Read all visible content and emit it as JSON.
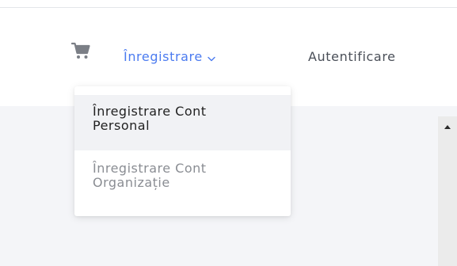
{
  "navbar": {
    "cart_icon": "shopping-cart-icon",
    "register_label": "Înregistrare",
    "register_chevron_icon": "chevron-down-icon",
    "login_label": "Autentificare",
    "accent_color": "#4b7bf0"
  },
  "dropdown": {
    "items": [
      {
        "label_line1": "Înregistrare Cont",
        "label_line2": "Personal",
        "state": "hovered"
      },
      {
        "label_line1": "Înregistrare Cont",
        "label_line2": "Organizație",
        "state": "default"
      }
    ]
  },
  "scrollbar": {
    "up_icon": "scroll-up-arrow-icon"
  }
}
